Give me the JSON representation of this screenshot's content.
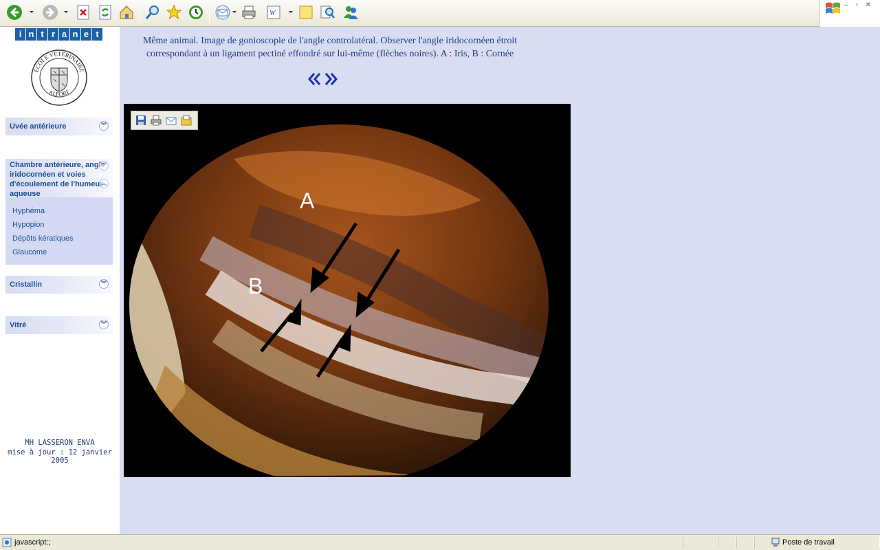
{
  "toolbar": {
    "icons": [
      "back-icon",
      "forward-icon",
      "stop-icon",
      "refresh-icon",
      "home-icon",
      "search-icon",
      "favorites-icon",
      "history-icon",
      "mail-icon",
      "print-icon",
      "edit-word-icon",
      "discuss-icon",
      "research-icon",
      "messenger-icon"
    ]
  },
  "sidebar": {
    "brand_letters": [
      "i",
      "n",
      "t",
      "r",
      "a",
      "n",
      "e",
      "t"
    ],
    "logo": {
      "top_text": "ECOLE VETERINAIRE",
      "bottom_text": "ALFORT"
    },
    "menu": [
      {
        "label": "Uvée antérieure"
      },
      {
        "label": "Chambre antérieure, angle iridocornéen et voies d'écoulement de l'humeur aqueuse"
      },
      {
        "label": "Cristallin"
      },
      {
        "label": "Vitré"
      }
    ],
    "submenu": [
      "Hyphéma",
      "Hypopion",
      "Dépôts kératiques",
      "Glaucome"
    ],
    "footer": {
      "author": "MH LASSERON ENVA",
      "updated": "mise à jour : 12 janvier 2005"
    }
  },
  "main": {
    "caption_line1": "Même animal. Image de gonioscopie de l'angle controlatéral. Observer l'angle iridocornéen étroit",
    "caption_line2": "correspondant à un ligament pectiné effondré sur lui-même (flèches noires). A : Iris, B : Cornée",
    "photo_labels": {
      "a": "A",
      "b": "B"
    }
  },
  "statusbar": {
    "left_text": "javascript:;",
    "zone": "Poste de travail"
  },
  "colors": {
    "accent": "#1b60a8",
    "page_bg": "#d8ddf1",
    "link": "#1b4f93"
  }
}
